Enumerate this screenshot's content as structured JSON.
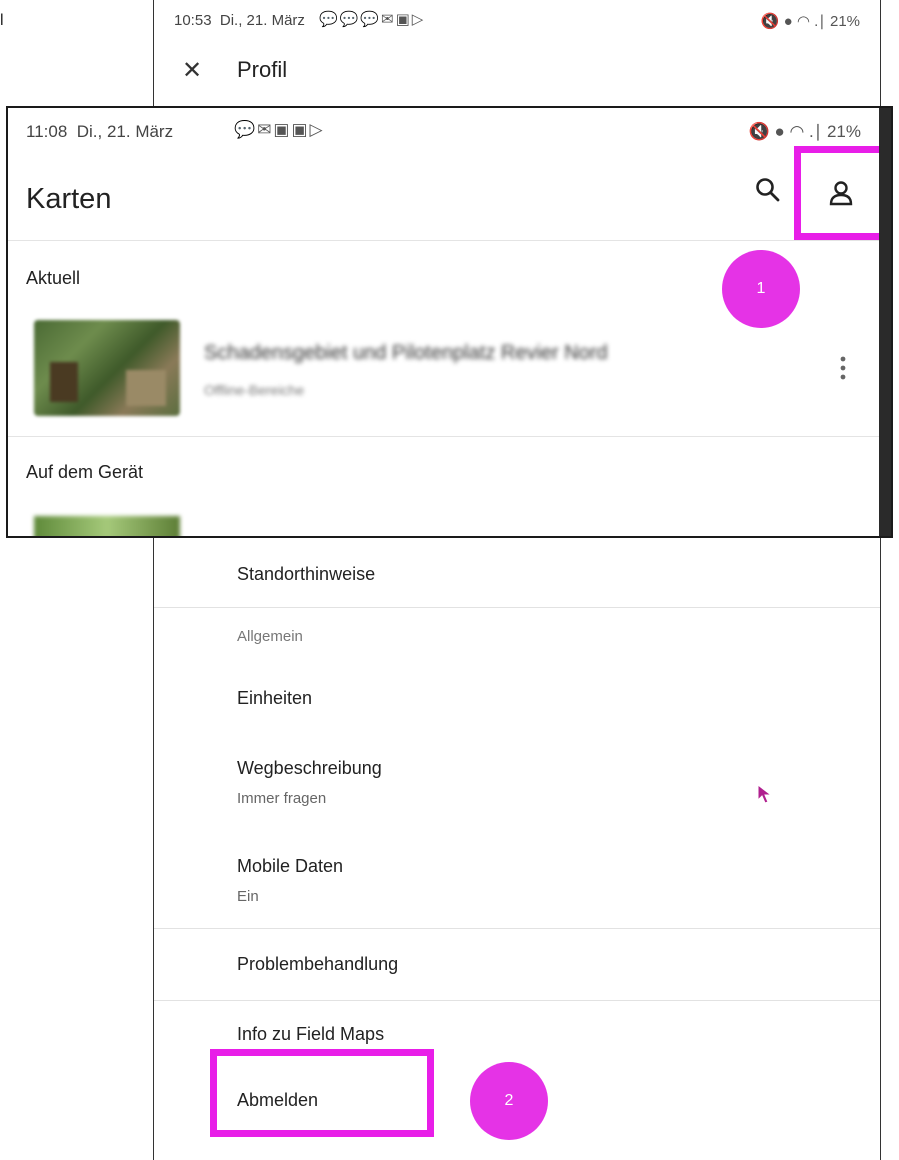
{
  "edge_label": "l",
  "profil_screen": {
    "status": {
      "time": "10:53",
      "date": "Di., 21. März",
      "notification_icons": "💬💬💬✉▣▷",
      "right": "🔇 ● ◠ .∣ 21%"
    },
    "title": "Profil",
    "close_icon": "close-icon",
    "items": {
      "standort": "Standorthinweise",
      "allgemein": "Allgemein",
      "einheiten": "Einheiten",
      "wegbeschreibung": "Wegbeschreibung",
      "wegbeschreibung_value": "Immer fragen",
      "mobile_daten": "Mobile Daten",
      "mobile_daten_value": "Ein",
      "problembehandlung": "Problembehandlung",
      "info": "Info zu Field Maps",
      "abmelden": "Abmelden"
    }
  },
  "karten_screen": {
    "status": {
      "time": "11:08",
      "date": "Di., 21. März",
      "notification_icons": "💬✉▣▣▷",
      "right": "🔇 ● ◠ .∣ 21%"
    },
    "title": "Karten",
    "sections": {
      "aktuell": "Aktuell",
      "auf_dem_geraet": "Auf dem Gerät"
    },
    "recent_map": {
      "title": "Schadensgebiet und Pilotenplatz Revier Nord",
      "subtitle": "Offline-Bereiche"
    },
    "icons": {
      "search": "search-icon",
      "account": "account-icon",
      "more": "more-vert-icon"
    }
  },
  "annotations": {
    "badge_1": "1",
    "badge_2": "2",
    "highlight_color": "#e81ee8",
    "badge_color": "#e533e6"
  }
}
